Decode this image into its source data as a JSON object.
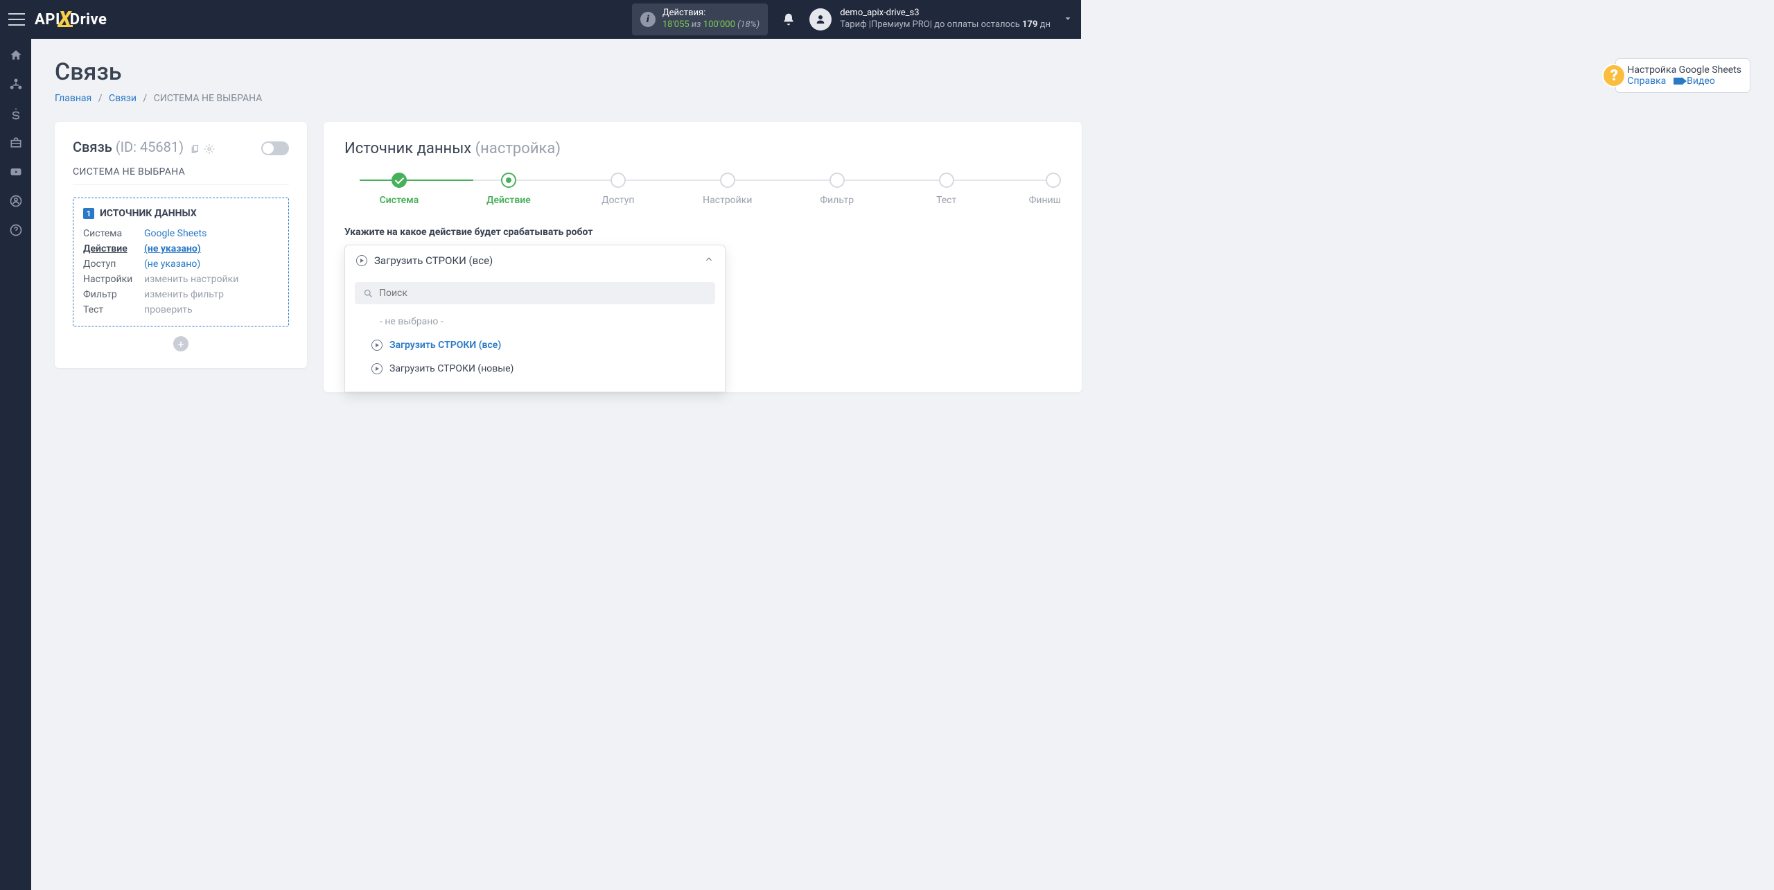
{
  "header": {
    "logo_prefix": "API",
    "logo_suffix": "Drive",
    "actions_label": "Действия:",
    "actions_used": "18'055",
    "actions_of": " из ",
    "actions_total": "100'000",
    "actions_percent": " (18%)",
    "user_name": "demo_apix-drive_s3",
    "tariff_prefix": "Тариф |Премиум PRO| до оплаты осталось ",
    "tariff_days": "179",
    "tariff_suffix": " дн"
  },
  "page": {
    "title": "Связь",
    "breadcrumb_home": "Главная",
    "breadcrumb_links": "Связи",
    "breadcrumb_current": "СИСТЕМА НЕ ВЫБРАНА"
  },
  "help": {
    "title": "Настройка Google Sheets",
    "link_help": "Справка",
    "link_video": "Видео"
  },
  "left": {
    "title_main": "Связь",
    "title_id": " (ID: 45681)",
    "sub_label": "СИСТЕМА НЕ ВЫБРАНА",
    "box_title": "ИСТОЧНИК ДАННЫХ",
    "rows": {
      "system_label": "Система",
      "system_val": "Google Sheets",
      "action_label": "Действие",
      "action_val": "(не указано)",
      "access_label": "Доступ",
      "access_val": "(не указано)",
      "settings_label": "Настройки",
      "settings_val": "изменить настройки",
      "filter_label": "Фильтр",
      "filter_val": "изменить фильтр",
      "test_label": "Тест",
      "test_val": "проверить"
    }
  },
  "right": {
    "title_main": "Источник данных ",
    "title_sub": "(настройка)",
    "steps": [
      "Система",
      "Действие",
      "Доступ",
      "Настройки",
      "Фильтр",
      "Тест",
      "Финиш"
    ],
    "section_label": "Укажите на какое действие будет срабатывать робот",
    "selected": "Загрузить СТРОКИ (все)",
    "search_placeholder": "Поиск",
    "options": {
      "none": "- не выбрано -",
      "all": "Загрузить СТРОКИ (все)",
      "new": "Загрузить СТРОКИ (новые)"
    }
  }
}
